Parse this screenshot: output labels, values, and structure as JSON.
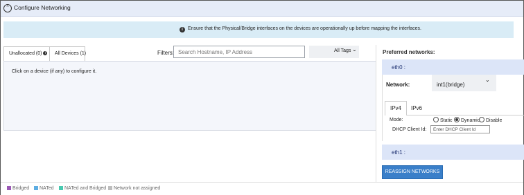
{
  "header": {
    "title": "Configure Networking",
    "collapse_icon": "chevron-up-circle-icon"
  },
  "info": {
    "icon": "info-icon",
    "message": "Ensure that the Physical/Bridge interfaces on the devices are operationally up before mapping the interfaces."
  },
  "devices": {
    "tabs": [
      {
        "label": "Unallocated (0)",
        "icon": "info-icon"
      },
      {
        "label": "All Devices (1)"
      }
    ],
    "hint": "Click on a device (if any) to configure it."
  },
  "filters": {
    "label": "Filters:",
    "placeholder": "Search Hostname, IP Address",
    "tags_label": "All Tags"
  },
  "preferred": {
    "label": "Preferred networks:",
    "interfaces": [
      {
        "name": "eth0 :",
        "network_label": "Network:",
        "network_value": "int1(bridge)",
        "ip_tabs": [
          "IPv4",
          "IPv6"
        ],
        "mode_label": "Mode:",
        "modes": [
          {
            "label": "Static",
            "selected": false
          },
          {
            "label": "Dynamic",
            "selected": true
          },
          {
            "label": "Disable",
            "selected": false
          }
        ],
        "dhcp_label": "DHCP Client Id:",
        "dhcp_placeholder": "Enter DHCP Client Id"
      },
      {
        "name": "eth1 :"
      }
    ],
    "reassign_label": "REASSIGN NETWORKS"
  },
  "legend": [
    {
      "label": "Bridged",
      "color": "#9b59b6"
    },
    {
      "label": "NATed",
      "color": "#5dade2"
    },
    {
      "label": "NATed and Bridged",
      "color": "#48c9b0"
    },
    {
      "label": "Network not assigned",
      "color": "#bdbdbd"
    }
  ],
  "colors": {
    "accent": "#3a7fc9",
    "header_bg": "#e6ecf8",
    "info_bg": "#d9ecf6"
  }
}
